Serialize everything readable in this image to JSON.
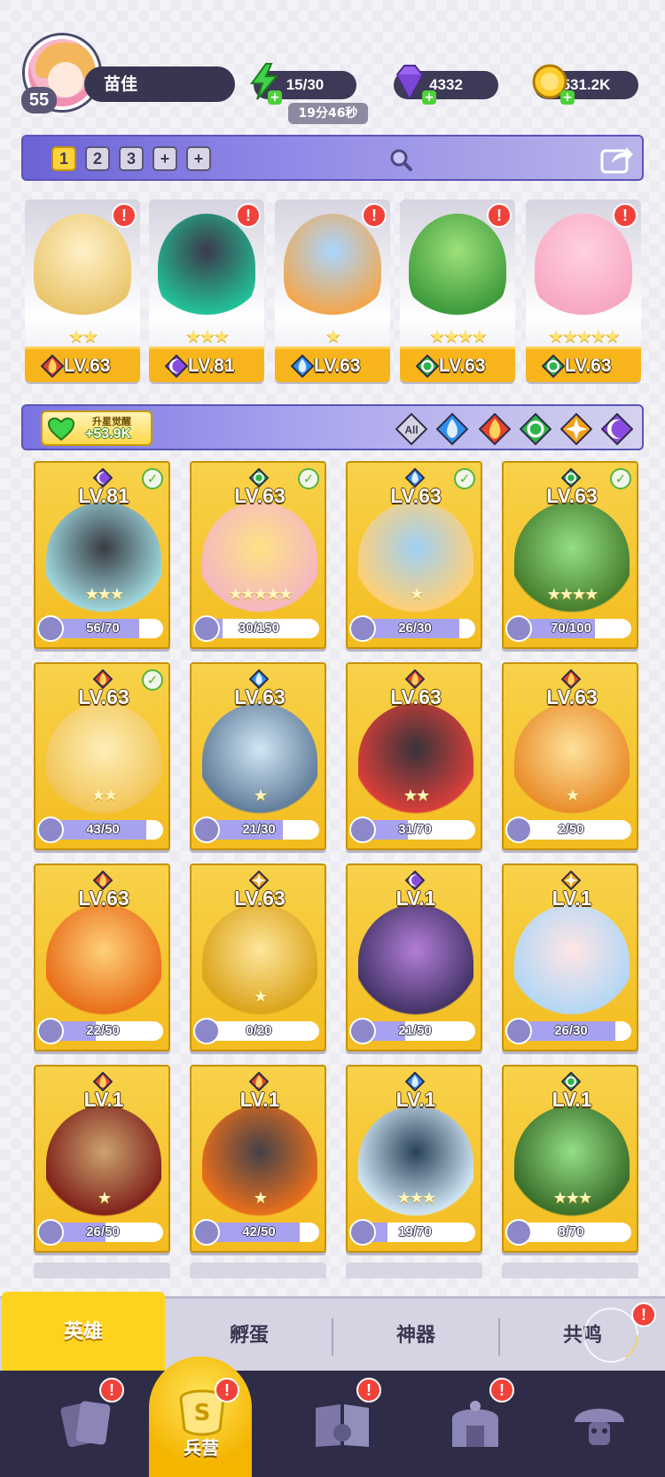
{
  "player": {
    "level": "55",
    "name": "苗佳"
  },
  "resources": {
    "energy": {
      "value": "15/30",
      "timer": "19分46秒"
    },
    "gems": {
      "value": "4332"
    },
    "gold": {
      "value": "531.2K"
    }
  },
  "team_tabs": [
    "1",
    "2",
    "3",
    "+",
    "+"
  ],
  "team_heroes": [
    {
      "level": "LV.63",
      "stars": "★★",
      "element": "fire",
      "alert": "!"
    },
    {
      "level": "LV.81",
      "stars": "★★★",
      "element": "dark",
      "alert": "!"
    },
    {
      "level": "LV.63",
      "stars": "★",
      "element": "water",
      "alert": "!"
    },
    {
      "level": "LV.63",
      "stars": "★★★★",
      "element": "wind",
      "alert": "!"
    },
    {
      "level": "LV.63",
      "stars": "★★★★★",
      "element": "wind",
      "alert": "!"
    }
  ],
  "awaken": {
    "title": "升星觉醒",
    "value": "+53.9K"
  },
  "filters": [
    "All",
    "water",
    "fire",
    "wind",
    "light",
    "dark"
  ],
  "heroes": [
    {
      "level": "LV.81",
      "element": "dark",
      "checked": true,
      "stars": "★★★",
      "fragments": "56/70",
      "progress": 0.8
    },
    {
      "level": "LV.63",
      "element": "wind",
      "checked": true,
      "stars": "★★★★★",
      "fragments": "30/150",
      "progress": 0.2
    },
    {
      "level": "LV.63",
      "element": "water",
      "checked": true,
      "stars": "★",
      "fragments": "26/30",
      "progress": 0.87
    },
    {
      "level": "LV.63",
      "element": "wind",
      "checked": true,
      "stars": "★★★★",
      "fragments": "70/100",
      "progress": 0.7
    },
    {
      "level": "LV.63",
      "element": "fire",
      "checked": true,
      "stars": "★★",
      "fragments": "43/50",
      "progress": 0.86
    },
    {
      "level": "LV.63",
      "element": "water",
      "checked": false,
      "stars": "★",
      "fragments": "21/30",
      "progress": 0.7
    },
    {
      "level": "LV.63",
      "element": "fire",
      "checked": false,
      "stars": "★★",
      "fragments": "31/70",
      "progress": 0.44
    },
    {
      "level": "LV.63",
      "element": "fire",
      "checked": false,
      "stars": "★",
      "fragments": "2/50",
      "progress": 0.04
    },
    {
      "level": "LV.63",
      "element": "fire",
      "checked": false,
      "stars": "",
      "fragments": "22/50",
      "progress": 0.44
    },
    {
      "level": "LV.63",
      "element": "light",
      "checked": false,
      "stars": "★",
      "fragments": "0/20",
      "progress": 0
    },
    {
      "level": "LV.1",
      "element": "dark",
      "checked": false,
      "stars": "",
      "fragments": "21/50",
      "progress": 0.42
    },
    {
      "level": "LV.1",
      "element": "light",
      "checked": false,
      "stars": "",
      "fragments": "26/30",
      "progress": 0.87
    },
    {
      "level": "LV.1",
      "element": "fire",
      "checked": false,
      "stars": "★",
      "fragments": "26/50",
      "progress": 0.52
    },
    {
      "level": "LV.1",
      "element": "fire",
      "checked": false,
      "stars": "★",
      "fragments": "42/50",
      "progress": 0.84
    },
    {
      "level": "LV.1",
      "element": "water",
      "checked": false,
      "stars": "★★★",
      "fragments": "19/70",
      "progress": 0.27
    },
    {
      "level": "LV.1",
      "element": "wind",
      "checked": false,
      "stars": "★★★",
      "fragments": "8/70",
      "progress": 0.11
    }
  ],
  "subtabs": {
    "heroes": "英雄",
    "hatch": "孵蛋",
    "artifact": "神器",
    "resonance": "共鸣"
  },
  "nav": {
    "barracks": "兵营"
  },
  "colors": {
    "fire": "#e8432b",
    "water": "#2f8ff0",
    "wind": "#2fb54a",
    "light": "#f3a21a",
    "dark": "#8a4ce0",
    "accent": "#ffd21e",
    "alert": "#f0423a"
  }
}
